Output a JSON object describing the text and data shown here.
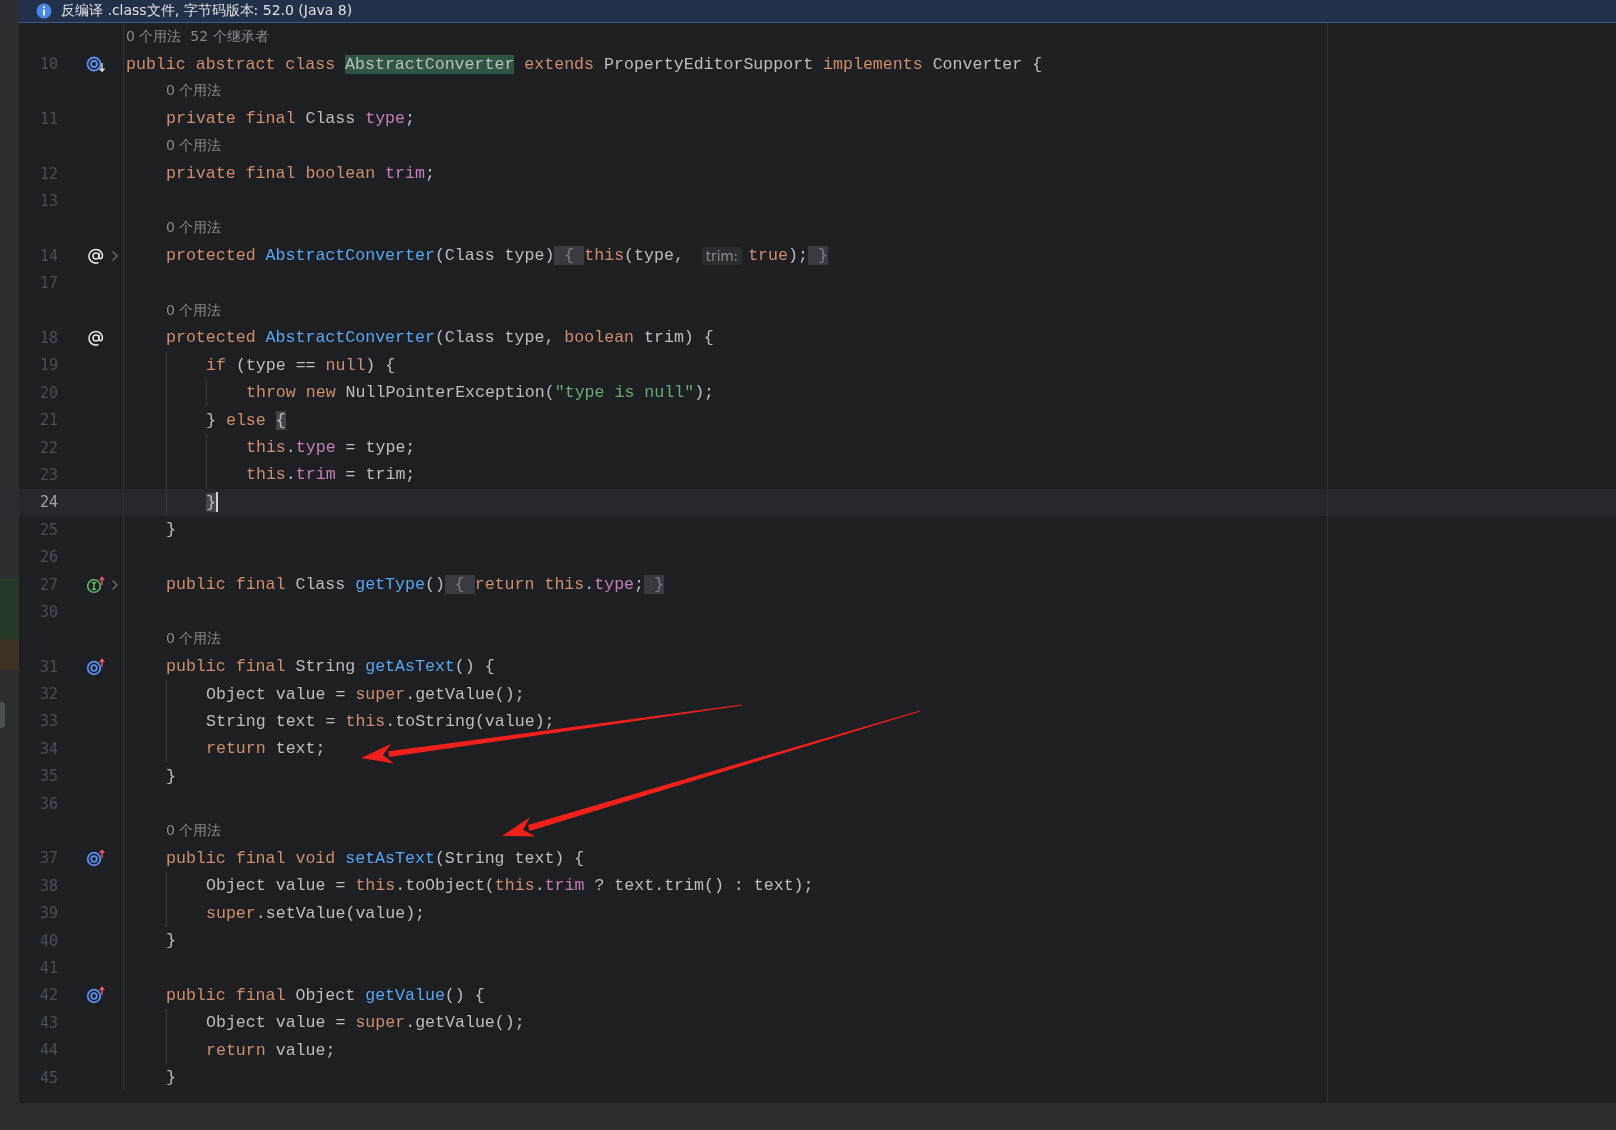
{
  "banner": {
    "text": "反编译 .class文件, 字节码版本: 52.0 (Java 8)"
  },
  "rows": [
    {
      "kind": "hint",
      "text": "0 个用法  52 个继承者"
    },
    {
      "kind": "code",
      "number": "10",
      "gutter_icon": {
        "kind": "implemented"
      },
      "fold": false,
      "current": false,
      "tokens": [
        {
          "text": "public abstract class ",
          "kind": "text",
          "color": "#cf8e6d"
        },
        {
          "text": "AbstractConverter",
          "kind": "highlight"
        },
        {
          "text": " extends",
          "kind": "text",
          "color": "#cf8e6d"
        },
        {
          "text": " PropertyEditorSupport ",
          "kind": "text"
        },
        {
          "text": "implements",
          "kind": "text",
          "color": "#cf8e6d"
        },
        {
          "text": " Converter {",
          "kind": "text"
        }
      ],
      "children": [
        {
          "kind": "hint",
          "text": "0 个用法"
        },
        {
          "kind": "code",
          "number": "11",
          "fold": false,
          "current": false,
          "tokens": [
            {
              "text": "private final ",
              "kind": "text",
              "color": "#cf8e6d"
            },
            {
              "text": "Class ",
              "kind": "text"
            },
            {
              "text": "type",
              "kind": "text",
              "color": "#c77dbb"
            },
            {
              "text": ";",
              "kind": "text"
            }
          ]
        },
        {
          "kind": "hint",
          "text": "0 个用法"
        },
        {
          "kind": "code",
          "number": "12",
          "fold": false,
          "current": false,
          "tokens": [
            {
              "text": "private final boolean ",
              "kind": "text",
              "color": "#cf8e6d"
            },
            {
              "text": "trim",
              "kind": "text",
              "color": "#c77dbb"
            },
            {
              "text": ";",
              "kind": "text"
            }
          ]
        },
        {
          "kind": "code",
          "number": "13",
          "fold": false,
          "current": false
        },
        {
          "kind": "hint",
          "text": "0 个用法"
        },
        {
          "kind": "code",
          "number": "14",
          "gutter_icon": {
            "kind": "annotation"
          },
          "fold": true,
          "current": false,
          "tokens": [
            {
              "text": "protected ",
              "kind": "text",
              "color": "#cf8e6d"
            },
            {
              "text": "AbstractConverter",
              "kind": "text",
              "color": "#56a8f5"
            },
            {
              "text": "(Class type)",
              "kind": "text"
            },
            {
              "text": " { ",
              "kind": "folded"
            },
            {
              "text": "this",
              "kind": "text",
              "color": "#cf8e6d"
            },
            {
              "text": "(type, ",
              "kind": "text"
            },
            {
              "text": "trim:",
              "kind": "hint"
            },
            {
              "text": "true",
              "kind": "text",
              "color": "#cf8e6d"
            },
            {
              "text": ");",
              "kind": "text"
            },
            {
              "text": " }",
              "kind": "folded"
            }
          ]
        },
        {
          "kind": "code",
          "number": "17",
          "fold": false,
          "current": false
        },
        {
          "kind": "hint",
          "text": "0 个用法"
        },
        {
          "kind": "code",
          "number": "18",
          "gutter_icon": {
            "kind": "annotation"
          },
          "fold": false,
          "current": false,
          "tokens": [
            {
              "text": "protected ",
              "kind": "text",
              "color": "#cf8e6d"
            },
            {
              "text": "AbstractConverter",
              "kind": "text",
              "color": "#56a8f5"
            },
            {
              "text": "(Class type, ",
              "kind": "text"
            },
            {
              "text": "boolean",
              "kind": "text",
              "color": "#cf8e6d"
            },
            {
              "text": " trim) {",
              "kind": "text"
            }
          ],
          "children": [
            {
              "kind": "code",
              "number": "19",
              "fold": false,
              "current": false,
              "tokens": [
                {
                  "text": "if",
                  "kind": "text",
                  "color": "#cf8e6d"
                },
                {
                  "text": " (type == ",
                  "kind": "text"
                },
                {
                  "text": "null",
                  "kind": "text",
                  "color": "#cf8e6d"
                },
                {
                  "text": ") {",
                  "kind": "text"
                }
              ],
              "children": [
                {
                  "kind": "code",
                  "number": "20",
                  "fold": false,
                  "current": false,
                  "tokens": [
                    {
                      "text": "throw new ",
                      "kind": "text",
                      "color": "#cf8e6d"
                    },
                    {
                      "text": "NullPointerException(",
                      "kind": "text"
                    },
                    {
                      "text": "\"type is null\"",
                      "kind": "text",
                      "color": "#6aab73"
                    },
                    {
                      "text": ");",
                      "kind": "text"
                    }
                  ]
                }
              ]
            },
            {
              "kind": "code",
              "number": "21",
              "fold": false,
              "current": false,
              "tokens": [
                {
                  "text": "}",
                  "kind": "text"
                },
                {
                  "text": " else ",
                  "kind": "text",
                  "color": "#cf8e6d"
                },
                {
                  "text": "{",
                  "kind": "match"
                }
              ],
              "children": [
                {
                  "kind": "code",
                  "number": "22",
                  "fold": false,
                  "current": false,
                  "tokens": [
                    {
                      "text": "this",
                      "kind": "text",
                      "color": "#cf8e6d"
                    },
                    {
                      "text": ".",
                      "kind": "text"
                    },
                    {
                      "text": "type",
                      "kind": "text",
                      "color": "#c77dbb"
                    },
                    {
                      "text": " = type;",
                      "kind": "text"
                    }
                  ]
                },
                {
                  "kind": "code",
                  "number": "23",
                  "fold": false,
                  "current": false,
                  "tokens": [
                    {
                      "text": "this",
                      "kind": "text",
                      "color": "#cf8e6d"
                    },
                    {
                      "text": ".",
                      "kind": "text"
                    },
                    {
                      "text": "trim",
                      "kind": "text",
                      "color": "#c77dbb"
                    },
                    {
                      "text": " = trim;",
                      "kind": "text"
                    }
                  ]
                }
              ]
            },
            {
              "kind": "code",
              "number": "24",
              "fold": false,
              "current": true,
              "tokens": [
                {
                  "text": "}",
                  "kind": "match"
                }
              ]
            }
          ]
        },
        {
          "kind": "code",
          "number": "25",
          "fold": false,
          "current": false,
          "tokens": [
            {
              "text": "}",
              "kind": "text"
            }
          ]
        },
        {
          "kind": "code",
          "number": "26",
          "fold": false,
          "current": false
        },
        {
          "kind": "code",
          "number": "27",
          "gutter_icon": {
            "kind": "interface"
          },
          "fold": true,
          "current": false,
          "tokens": [
            {
              "text": "public final ",
              "kind": "text",
              "color": "#cf8e6d"
            },
            {
              "text": "Class ",
              "kind": "text"
            },
            {
              "text": "getType",
              "kind": "text",
              "color": "#56a8f5"
            },
            {
              "text": "()",
              "kind": "text"
            },
            {
              "text": " { ",
              "kind": "folded"
            },
            {
              "text": "return this",
              "kind": "text",
              "color": "#cf8e6d"
            },
            {
              "text": ".",
              "kind": "text"
            },
            {
              "text": "type",
              "kind": "text",
              "color": "#c77dbb"
            },
            {
              "text": ";",
              "kind": "text"
            },
            {
              "text": " }",
              "kind": "folded"
            }
          ]
        },
        {
          "kind": "code",
          "number": "30",
          "fold": false,
          "current": false
        },
        {
          "kind": "hint",
          "text": "0 个用法"
        },
        {
          "kind": "code",
          "number": "31",
          "gutter_icon": {
            "kind": "override"
          },
          "fold": false,
          "current": false,
          "tokens": [
            {
              "text": "public final ",
              "kind": "text",
              "color": "#cf8e6d"
            },
            {
              "text": "String ",
              "kind": "text"
            },
            {
              "text": "getAsText",
              "kind": "text",
              "color": "#56a8f5"
            },
            {
              "text": "() {",
              "kind": "text"
            }
          ],
          "children": [
            {
              "kind": "code",
              "number": "32",
              "fold": false,
              "current": false,
              "tokens": [
                {
                  "text": "Object value = ",
                  "kind": "text"
                },
                {
                  "text": "super",
                  "kind": "text",
                  "color": "#cf8e6d"
                },
                {
                  "text": ".getValue();",
                  "kind": "text"
                }
              ]
            },
            {
              "kind": "code",
              "number": "33",
              "fold": false,
              "current": false,
              "tokens": [
                {
                  "text": "String text = ",
                  "kind": "text"
                },
                {
                  "text": "this",
                  "kind": "text",
                  "color": "#cf8e6d"
                },
                {
                  "text": ".toString(value);",
                  "kind": "text"
                }
              ]
            },
            {
              "kind": "code",
              "number": "34",
              "fold": false,
              "current": false,
              "tokens": [
                {
                  "text": "return",
                  "kind": "text",
                  "color": "#cf8e6d"
                },
                {
                  "text": " text;",
                  "kind": "text"
                }
              ]
            }
          ]
        },
        {
          "kind": "code",
          "number": "35",
          "fold": false,
          "current": false,
          "tokens": [
            {
              "text": "}",
              "kind": "text"
            }
          ]
        },
        {
          "kind": "code",
          "number": "36",
          "fold": false,
          "current": false
        },
        {
          "kind": "hint",
          "text": "0 个用法"
        },
        {
          "kind": "code",
          "number": "37",
          "gutter_icon": {
            "kind": "override"
          },
          "fold": false,
          "current": false,
          "tokens": [
            {
              "text": "public final void ",
              "kind": "text",
              "color": "#cf8e6d"
            },
            {
              "text": "setAsText",
              "kind": "text",
              "color": "#56a8f5"
            },
            {
              "text": "(String text) {",
              "kind": "text"
            }
          ],
          "children": [
            {
              "kind": "code",
              "number": "38",
              "fold": false,
              "current": false,
              "tokens": [
                {
                  "text": "Object value = ",
                  "kind": "text"
                },
                {
                  "text": "this",
                  "kind": "text",
                  "color": "#cf8e6d"
                },
                {
                  "text": ".toObject(",
                  "kind": "text"
                },
                {
                  "text": "this",
                  "kind": "text",
                  "color": "#cf8e6d"
                },
                {
                  "text": ".",
                  "kind": "text"
                },
                {
                  "text": "trim",
                  "kind": "text",
                  "color": "#c77dbb"
                },
                {
                  "text": " ? text.trim() : text);",
                  "kind": "text"
                }
              ]
            },
            {
              "kind": "code",
              "number": "39",
              "fold": false,
              "current": false,
              "tokens": [
                {
                  "text": "super",
                  "kind": "text",
                  "color": "#cf8e6d"
                },
                {
                  "text": ".setValue(value);",
                  "kind": "text"
                }
              ]
            }
          ]
        },
        {
          "kind": "code",
          "number": "40",
          "fold": false,
          "current": false,
          "tokens": [
            {
              "text": "}",
              "kind": "text"
            }
          ]
        },
        {
          "kind": "code",
          "number": "41",
          "fold": false,
          "current": false
        },
        {
          "kind": "code",
          "number": "42",
          "gutter_icon": {
            "kind": "override"
          },
          "fold": false,
          "current": false,
          "tokens": [
            {
              "text": "public final ",
              "kind": "text",
              "color": "#cf8e6d"
            },
            {
              "text": "Object ",
              "kind": "text"
            },
            {
              "text": "getValue",
              "kind": "text",
              "color": "#56a8f5"
            },
            {
              "text": "() {",
              "kind": "text"
            }
          ],
          "children": [
            {
              "kind": "code",
              "number": "43",
              "fold": false,
              "current": false,
              "tokens": [
                {
                  "text": "Object value = ",
                  "kind": "text"
                },
                {
                  "text": "super",
                  "kind": "text",
                  "color": "#cf8e6d"
                },
                {
                  "text": ".getValue();",
                  "kind": "text"
                }
              ]
            },
            {
              "kind": "code",
              "number": "44",
              "fold": false,
              "current": false,
              "tokens": [
                {
                  "text": "return",
                  "kind": "text",
                  "color": "#cf8e6d"
                },
                {
                  "text": " value;",
                  "kind": "text"
                }
              ]
            }
          ]
        },
        {
          "kind": "code",
          "number": "45",
          "fold": false,
          "current": false,
          "tokens": [
            {
              "text": "}",
              "kind": "text"
            }
          ]
        }
      ]
    }
  ],
  "annotation_arrows": [
    {
      "kind": "arrow"
    },
    {
      "kind": "arrow"
    }
  ]
}
